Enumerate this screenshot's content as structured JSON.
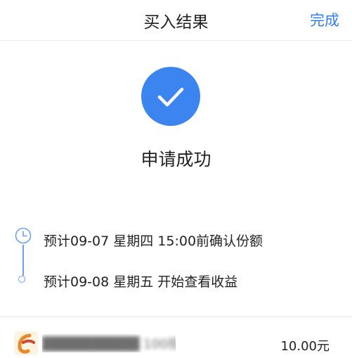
{
  "header": {
    "title": "买入结果",
    "done_label": "完成"
  },
  "result": {
    "status": "申请成功",
    "icon": "checkmark-icon",
    "color": "#3c84f0"
  },
  "timeline": {
    "steps": [
      {
        "text": "预计09-07 星期四 15:00前确认份额",
        "icon": "clock-icon"
      },
      {
        "text": "预计09-08 星期五 开始查看收益",
        "icon": "dot-icon"
      }
    ]
  },
  "fund": {
    "name": "██████████ 100指数",
    "amount": "10.00元",
    "logo": "fund-company-logo"
  },
  "colors": {
    "accent": "#2f80ed",
    "timeline": "#6aa0ee"
  }
}
